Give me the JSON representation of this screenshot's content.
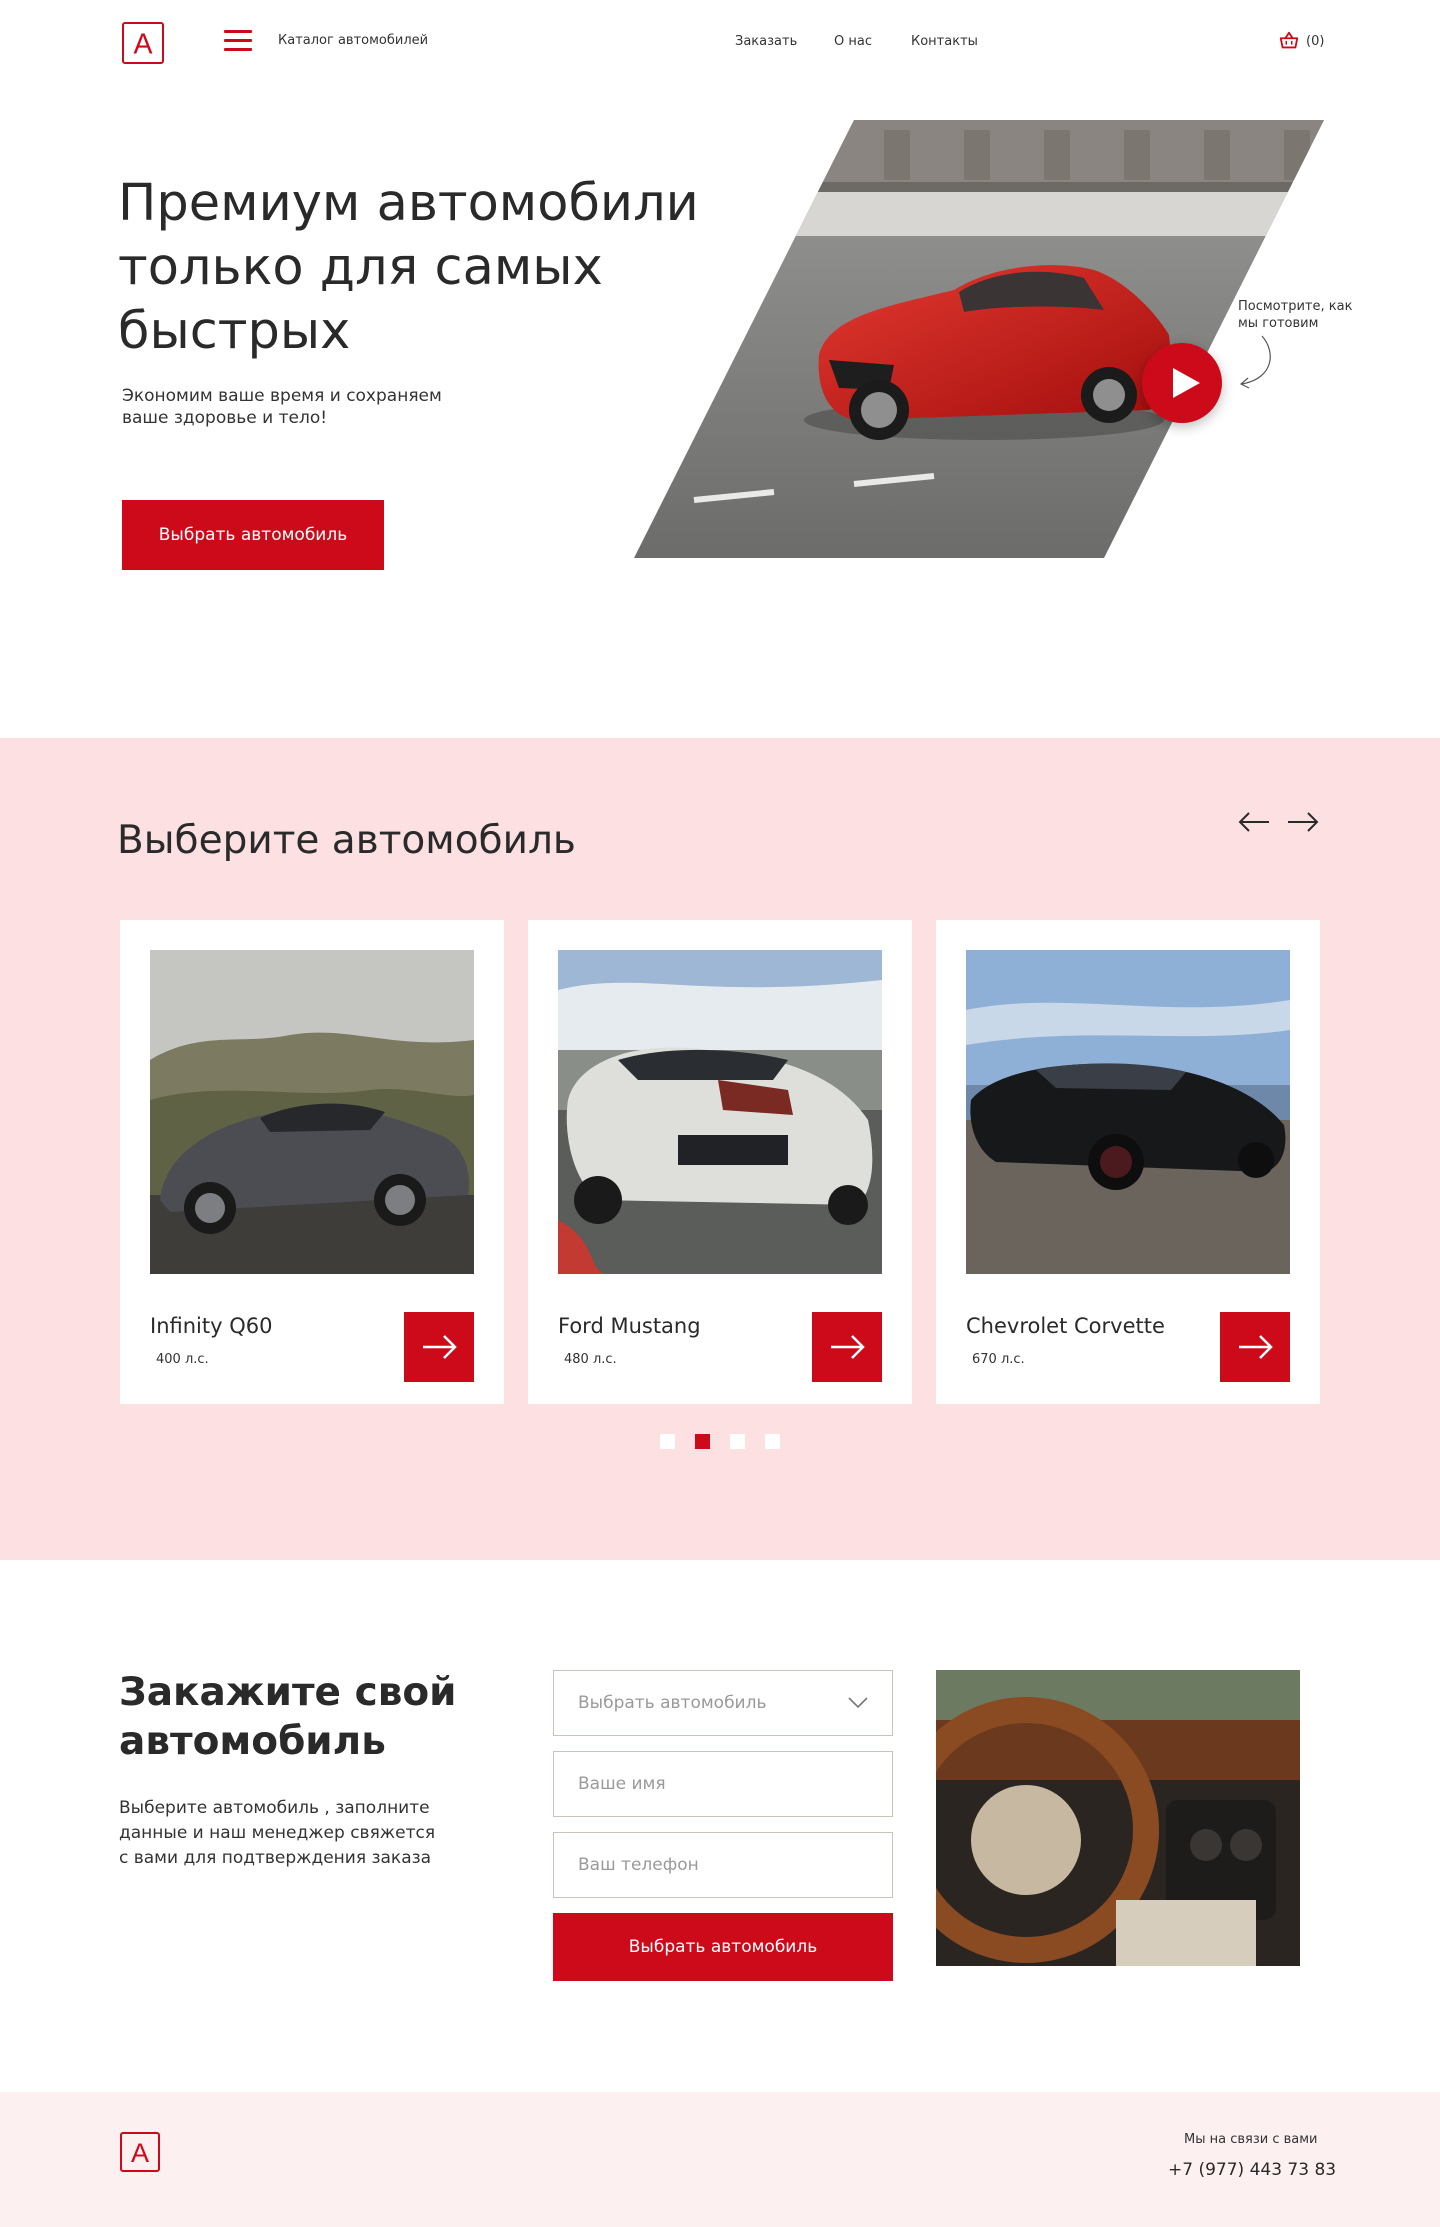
{
  "brand": {
    "logo_letter": "А"
  },
  "header": {
    "catalog_label": "Каталог автомобилей",
    "nav": [
      "Заказать",
      "О нас",
      "Контакты"
    ],
    "cart_count": "(0)"
  },
  "hero": {
    "title": "Премиум автомобили только для самых быстрых",
    "subtitle": "Экономим ваше время и сохраняем ваше здоровье и тело!",
    "button_label": "Выбрать автомобиль",
    "video_note": "Посмотрите, как мы готовим"
  },
  "choose": {
    "title": "Выберите автомобиль",
    "cards": [
      {
        "name": "Infinity Q60",
        "power": "400 л.с."
      },
      {
        "name": "Ford Mustang",
        "power": "480 л.с."
      },
      {
        "name": "Chevrolet Corvette",
        "power": "670 л.с."
      }
    ],
    "pager": {
      "pages": 4,
      "active_index": 1
    }
  },
  "order": {
    "title": "Закажите свой автомобиль",
    "text": "Выберите автомобиль , заполните данные и наш менеджер свяжется с вами для подтверждения заказа",
    "select_placeholder": "Выбрать автомобиль",
    "name_placeholder": "Ваше имя",
    "phone_placeholder": "Ваш телефон",
    "button_label": "Выбрать автомобиль"
  },
  "footer": {
    "contact_label": "Мы на связи с вами",
    "phone": "+7 (977) 443 73 83"
  },
  "colors": {
    "accent": "#cc0a1a",
    "section_bg": "#fde0e2",
    "footer_bg": "#fdf0f0"
  }
}
